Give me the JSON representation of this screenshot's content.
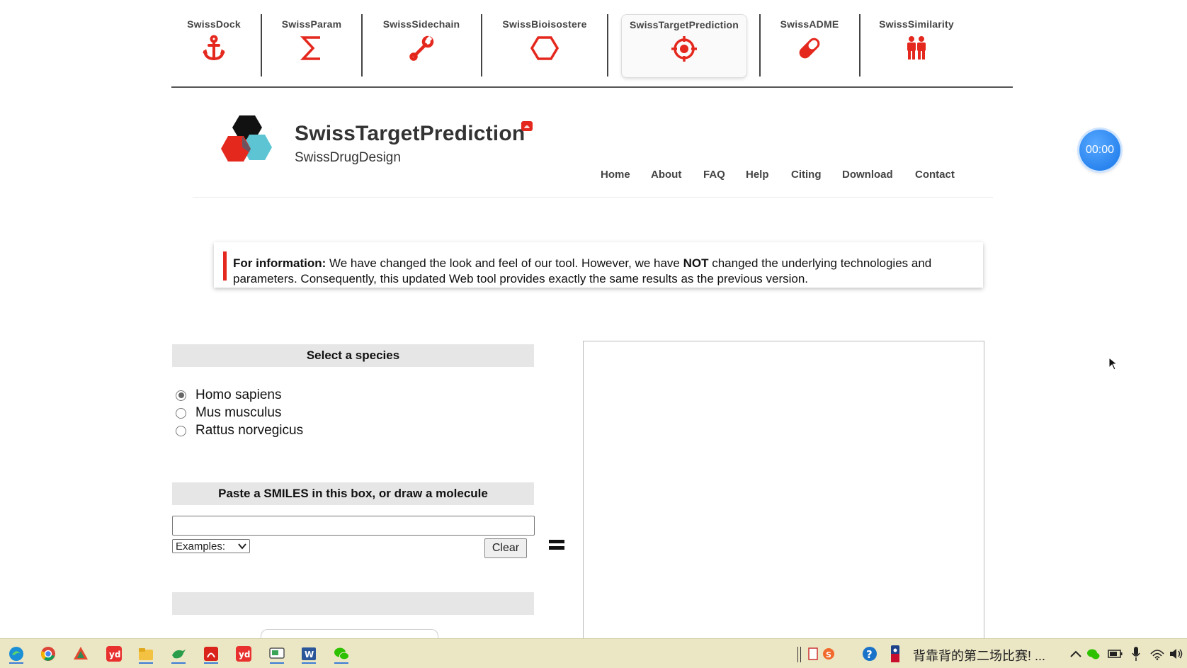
{
  "tool_nav": [
    {
      "name": "SwissDock",
      "icon": "anchor-icon"
    },
    {
      "name": "SwissParam",
      "icon": "sigma-icon"
    },
    {
      "name": "SwissSidechain",
      "icon": "wrench-icon"
    },
    {
      "name": "SwissBioisostere",
      "icon": "hexagon-icon"
    },
    {
      "name": "SwissTargetPrediction",
      "icon": "target-icon",
      "active": true
    },
    {
      "name": "SwissADME",
      "icon": "pill-icon"
    },
    {
      "name": "SwissSimilarity",
      "icon": "people-icon"
    }
  ],
  "header": {
    "title": "SwissTargetPrediction",
    "subtitle": "SwissDrugDesign",
    "menu": [
      "Home",
      "About",
      "FAQ",
      "Help",
      "Citing",
      "Download",
      "Contact"
    ]
  },
  "info": {
    "label": "For information:",
    "text1": " We have changed the look and feel of our tool. However, we have ",
    "emphasis": "NOT",
    "text2": " changed the underlying technologies and parameters. Consequently, this updated Web tool provides exactly the same results as the previous version."
  },
  "species": {
    "heading": "Select a species",
    "options": [
      "Homo sapiens",
      "Mus musculus",
      "Rattus norvegicus"
    ],
    "selected": "Homo sapiens"
  },
  "smiles": {
    "heading": "Paste a SMILES in this box, or draw a molecule",
    "value": "",
    "examples_label": "Examples:",
    "clear_label": "Clear"
  },
  "timer": "00:00",
  "taskbar": {
    "news": "背靠背的第二场比赛! ..."
  },
  "colors": {
    "accent_red": "#e4281e",
    "teal": "#5cc4d2",
    "taskbar_bg": "#ebe6c4",
    "timer_blue": "#1876e8"
  }
}
